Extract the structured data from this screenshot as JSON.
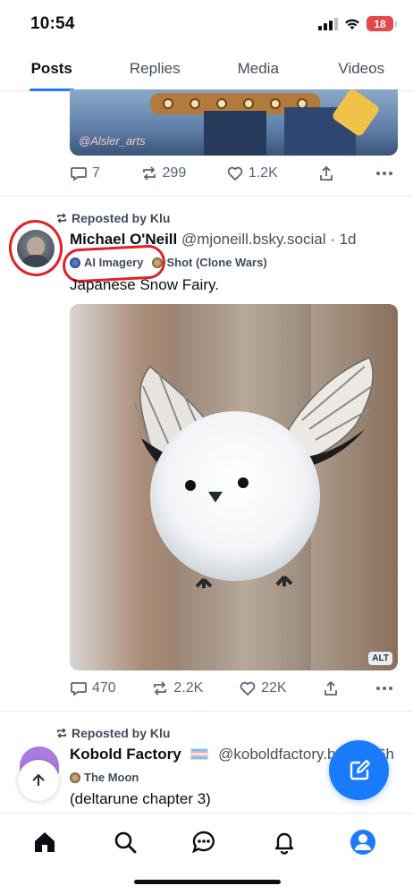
{
  "status": {
    "time": "10:54",
    "battery": "18"
  },
  "tabs": [
    {
      "label": "Posts",
      "active": true
    },
    {
      "label": "Replies",
      "active": false
    },
    {
      "label": "Media",
      "active": false
    },
    {
      "label": "Videos",
      "active": false
    }
  ],
  "posts": [
    {
      "image_signature": "@Alsler_arts",
      "replies": "7",
      "reposts": "299",
      "likes": "1.2K"
    },
    {
      "repost_text": "Reposted by Klu",
      "author_name": "Michael O'Neill",
      "author_handle": "@mjoneill.bsky.social · 1d",
      "labels": [
        "AI Imagery",
        "Shot (Clone Wars)"
      ],
      "text": "Japanese Snow Fairy.",
      "image_alt_badge": "ALT",
      "replies": "470",
      "reposts": "2.2K",
      "likes": "22K"
    },
    {
      "repost_text": "Reposted by Klu",
      "author_name": "Kobold Factory",
      "author_handle": "@koboldfactory.b",
      "time": "6h",
      "labels": [
        "The Moon"
      ],
      "text": "(deltarune chapter 3)"
    }
  ],
  "colors": {
    "accent": "#1a7bff",
    "annotation_red": "#e0202a",
    "battery_red": "#e5484d"
  },
  "bottom_nav": [
    "home-icon",
    "search-icon",
    "chat-icon",
    "bell-icon",
    "profile-icon"
  ]
}
